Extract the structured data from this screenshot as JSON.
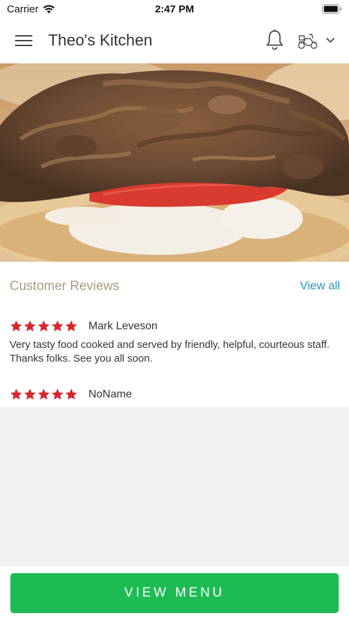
{
  "status_bar": {
    "carrier": "Carrier",
    "time": "2:47 PM"
  },
  "header": {
    "title": "Theo's Kitchen"
  },
  "hero": {
    "alt": "gyro-hero-image"
  },
  "reviews": {
    "title": "Customer Reviews",
    "view_all": "View all",
    "items": [
      {
        "rating": 5,
        "name": "Mark Leveson",
        "text": "Very tasty food cooked and served by friendly, helpful, courteous staff. Thanks folks. See you all soon."
      },
      {
        "rating": 5,
        "name": "NoName",
        "text": ""
      }
    ]
  },
  "footer": {
    "button_label": "VIEW MENU"
  },
  "colors": {
    "accent_green": "#1dbb54",
    "star_red": "#d9262c",
    "link_blue": "#2596c6",
    "section_title": "#ad9a7f"
  }
}
